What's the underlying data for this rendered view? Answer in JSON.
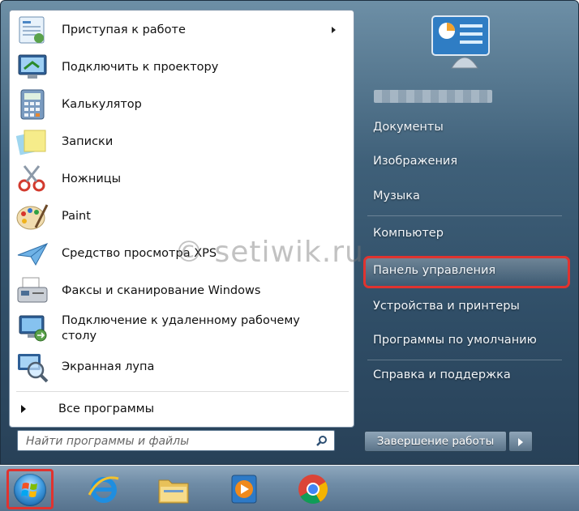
{
  "programs": [
    {
      "label": "Приступая к работе",
      "icon": "getting-started-icon",
      "has_submenu": true
    },
    {
      "label": "Подключить к проектору",
      "icon": "projector-icon",
      "has_submenu": false
    },
    {
      "label": "Калькулятор",
      "icon": "calculator-icon",
      "has_submenu": false
    },
    {
      "label": "Записки",
      "icon": "sticky-notes-icon",
      "has_submenu": false
    },
    {
      "label": "Ножницы",
      "icon": "scissors-icon",
      "has_submenu": false
    },
    {
      "label": "Paint",
      "icon": "paint-palette-icon",
      "has_submenu": false
    },
    {
      "label": "Средство просмотра XPS",
      "icon": "xps-viewer-icon",
      "has_submenu": false
    },
    {
      "label": "Факсы и сканирование Windows",
      "icon": "fax-scanner-icon",
      "has_submenu": false
    },
    {
      "label": "Подключение к удаленному рабочему столу",
      "icon": "remote-desktop-icon",
      "has_submenu": false
    },
    {
      "label": "Экранная лупа",
      "icon": "magnifier-icon",
      "has_submenu": false
    }
  ],
  "all_programs": "Все программы",
  "search": {
    "placeholder": "Найти программы и файлы",
    "icon": "search-icon"
  },
  "right_menu": [
    "Документы",
    "Изображения",
    "Музыка",
    "Компьютер",
    "Панель управления",
    "Устройства и принтеры",
    "Программы по умолчанию",
    "Справка и поддержка"
  ],
  "shutdown": {
    "label": "Завершение работы"
  },
  "watermark": "© setiwik.ru",
  "taskbar": {
    "start": "windows-start-orb-icon",
    "apps": [
      "internet-explorer-icon",
      "windows-explorer-icon",
      "media-player-icon",
      "chrome-icon"
    ]
  },
  "colors": {
    "highlight": "#e0332f",
    "menu_bg": "#3f6079",
    "taskbar": "#6f8ca6"
  }
}
